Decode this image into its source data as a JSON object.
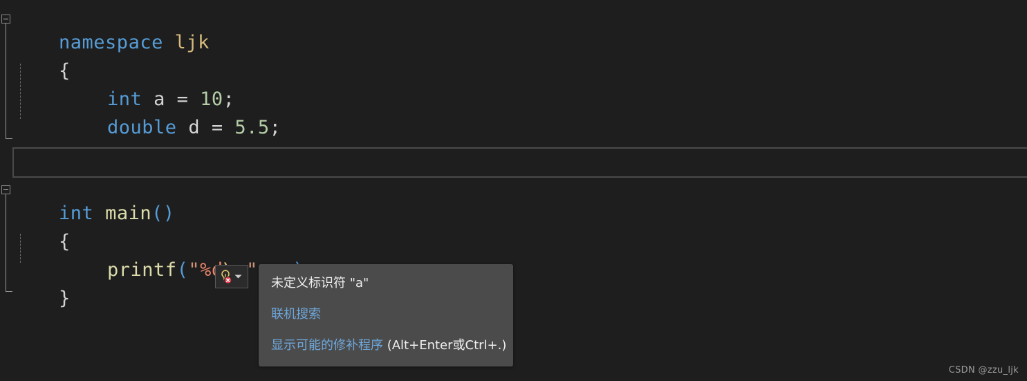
{
  "editor": {
    "background": "#1e1e1e",
    "foreground": "#d4d4d4",
    "lines": [
      {
        "indent": 0,
        "text": "namespace ljk"
      },
      {
        "indent": 0,
        "text": "{"
      },
      {
        "indent": 1,
        "text": "int a = 10;"
      },
      {
        "indent": 1,
        "text": "double d = 5.5;"
      },
      {
        "indent": 0,
        "text": "}"
      },
      {
        "indent": 0,
        "text": ""
      },
      {
        "indent": 0,
        "text": "int main()"
      },
      {
        "indent": 0,
        "text": "{"
      },
      {
        "indent": 1,
        "text": "printf(\"%d\\n\", a);"
      },
      {
        "indent": 0,
        "text": "}"
      }
    ],
    "tokens": {
      "namespace_kw": "namespace",
      "namespace_name": "ljk",
      "brace_open": "{",
      "brace_close": "}",
      "type_int": "int",
      "type_double": "double",
      "ident_a": "a",
      "ident_d": "d",
      "assign": " = ",
      "num_10": "10",
      "num_55": "5.5",
      "semi": ";",
      "fn_main": "main",
      "paren_open": "(",
      "paren_close": ")",
      "fn_printf": "printf",
      "quote": "\"",
      "fmt_spec": "%d",
      "escape_n": "\\n",
      "comma_space": ", ",
      "arg_a": "a"
    },
    "colors": {
      "keyword": "#569cd6",
      "type": "#569cd6",
      "identifier": "#d4d4d4",
      "namespace_name": "#d7ba7d",
      "number": "#b5cea8",
      "function": "#dcdcaa",
      "string": "#ce9178",
      "format_specifier": "#e8836a",
      "escape": "#d7ba7d",
      "error_squiggle": "#e51400"
    }
  },
  "quick_action": {
    "icon": "lightbulb-error-icon",
    "bulb_color": "#e9d16c",
    "badge_color": "#e8394a",
    "dropdown_glyph": "▼"
  },
  "tooltip": {
    "title": "未定义标识符 \"a\"",
    "search_link": "联机搜索",
    "fix_link": "显示可能的修补程序",
    "fix_shortcut": " (Alt+Enter或Ctrl+.)",
    "background": "#4b4b4b",
    "link_color": "#6fa8dc"
  },
  "watermark": {
    "text": "CSDN @zzu_ljk"
  }
}
